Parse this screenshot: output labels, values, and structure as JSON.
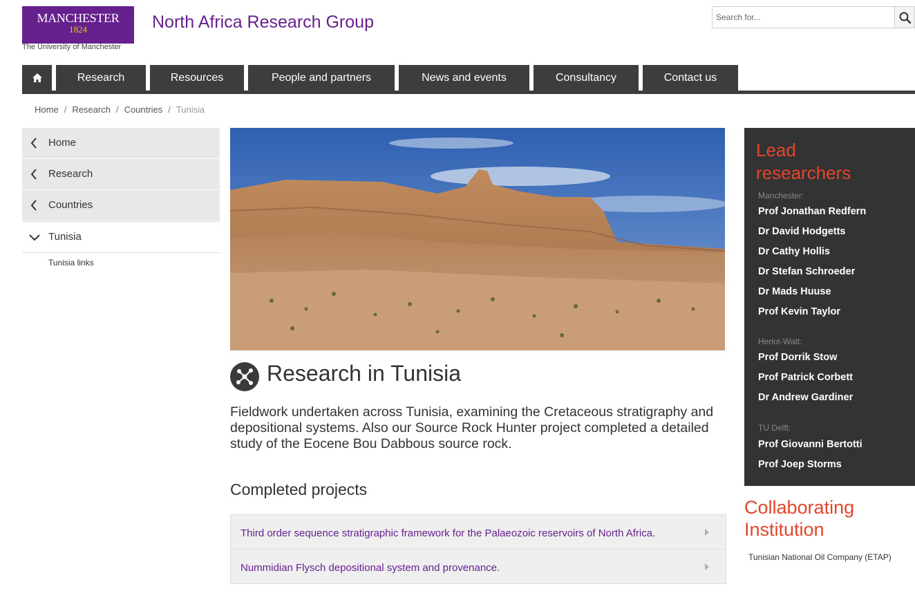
{
  "header": {
    "logo_word": "MANCHESTER",
    "logo_year": "1824",
    "logo_sub": "The University of Manchester",
    "site_title": "North Africa Research Group",
    "search_placeholder": "Search for..."
  },
  "nav": {
    "tabs": [
      "Research",
      "Resources",
      "People and partners",
      "News and events",
      "Consultancy",
      "Contact us"
    ]
  },
  "breadcrumb": [
    "Home",
    "Research",
    "Countries",
    "Tunisia"
  ],
  "leftnav": {
    "items": [
      "Home",
      "Research",
      "Countries"
    ],
    "active": "Tunisia",
    "sub": "Tunisia links"
  },
  "main": {
    "title": "Research in Tunisia",
    "intro": "Fieldwork undertaken across Tunisia, examining the Cretaceous stratigraphy and depositional systems. Also our Source Rock Hunter project completed a detailed study of the Eocene Bou Dabbous source rock.",
    "completed_heading": "Completed projects",
    "projects": [
      "Third order sequence stratigraphic framework for the Palaeozoic reservoirs of North Africa.",
      "Nummidian Flysch depositional system and provenance."
    ]
  },
  "sidebar": {
    "heading": "Lead researchers",
    "groups": [
      {
        "label": "Manchester:",
        "people": [
          "Prof Jonathan Redfern",
          "Dr David Hodgetts",
          "Dr Cathy Hollis",
          "Dr Stefan Schroeder",
          "Dr Mads Huuse",
          "Prof Kevin Taylor"
        ]
      },
      {
        "label": "Heriot-Watt:",
        "people": [
          "Prof Dorrik Stow",
          "Prof Patrick Corbett",
          "Dr Andrew Gardiner"
        ]
      },
      {
        "label": "TU Delft:",
        "people": [
          "Prof Giovanni Bertotti",
          "Prof Joep Storms"
        ]
      }
    ],
    "collab_heading": "Collaborating Institution",
    "collab_text": "Tunisian National Oil Company (ETAP)"
  },
  "colors": {
    "brand_purple": "#66218e",
    "accent_red": "#e4462b",
    "nav_dark": "#3d3d3d",
    "sidebar_dark": "#333333"
  }
}
